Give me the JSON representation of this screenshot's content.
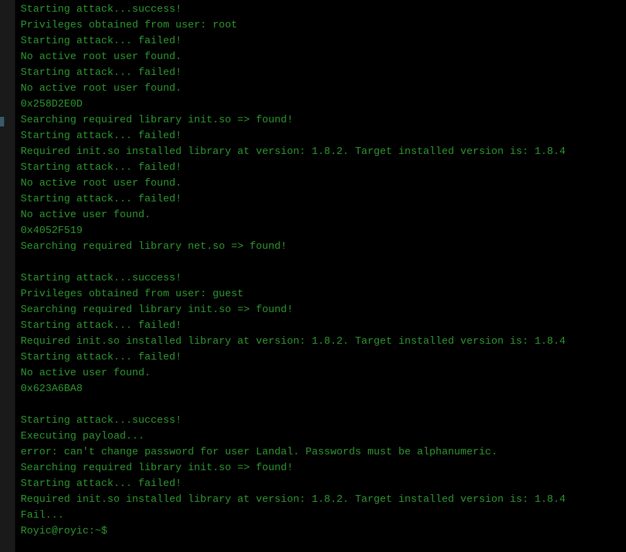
{
  "terminal": {
    "text_color": "#2e9930",
    "background_color": "#000000",
    "lines": [
      "Starting attack...success!",
      "Privileges obtained from user: root",
      "Starting attack... failed!",
      "No active root user found.",
      "Starting attack... failed!",
      "No active root user found.",
      "0x258D2E0D",
      "Searching required library init.so => found!",
      "Starting attack... failed!",
      "Required init.so installed library at version: 1.8.2. Target installed version is: 1.8.4",
      "Starting attack... failed!",
      "No active root user found.",
      "Starting attack... failed!",
      "No active user found.",
      "0x4052F519",
      "Searching required library net.so => found!",
      "",
      "Starting attack...success!",
      "Privileges obtained from user: guest",
      "Searching required library init.so => found!",
      "Starting attack... failed!",
      "Required init.so installed library at version: 1.8.2. Target installed version is: 1.8.4",
      "Starting attack... failed!",
      "No active user found.",
      "0x623A6BA8",
      "",
      "Starting attack...success!",
      "Executing payload...",
      "error: can't change password for user Landal. Passwords must be alphanumeric.",
      "Searching required library init.so => found!",
      "Starting attack... failed!",
      "Required init.so installed library at version: 1.8.2. Target installed version is: 1.8.4",
      "Fail..."
    ],
    "prompt": "Royic@royic:~$ "
  }
}
